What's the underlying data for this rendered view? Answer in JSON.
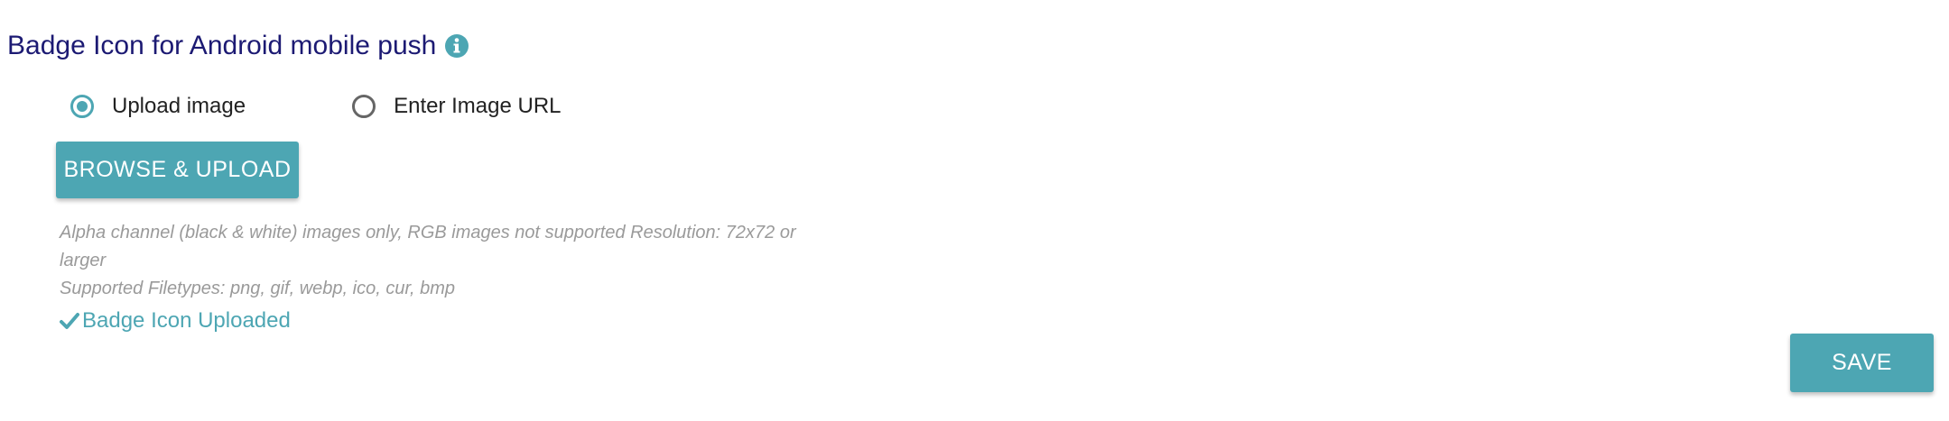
{
  "section": {
    "title": "Badge Icon for Android mobile push",
    "info_icon": "info-circle-icon"
  },
  "source_options": {
    "selected": "upload",
    "items": [
      {
        "label": "Upload image",
        "checked": true
      },
      {
        "label": "Enter Image URL",
        "checked": false
      }
    ]
  },
  "upload": {
    "button_label": "BROWSE & UPLOAD",
    "hint_lines": [
      "Alpha channel (black & white) images only, RGB images not supported Resolution: 72x72 or larger",
      "Supported Filetypes: png, gif, webp, ico, cur, bmp"
    ],
    "status_icon": "checkmark-icon",
    "status_text": "Badge Icon Uploaded"
  },
  "actions": {
    "save_label": "SAVE"
  },
  "colors": {
    "title": "#1c1a73",
    "accent": "#4da6b3",
    "hint_text": "#9a9a9a",
    "body_text": "#222222"
  }
}
